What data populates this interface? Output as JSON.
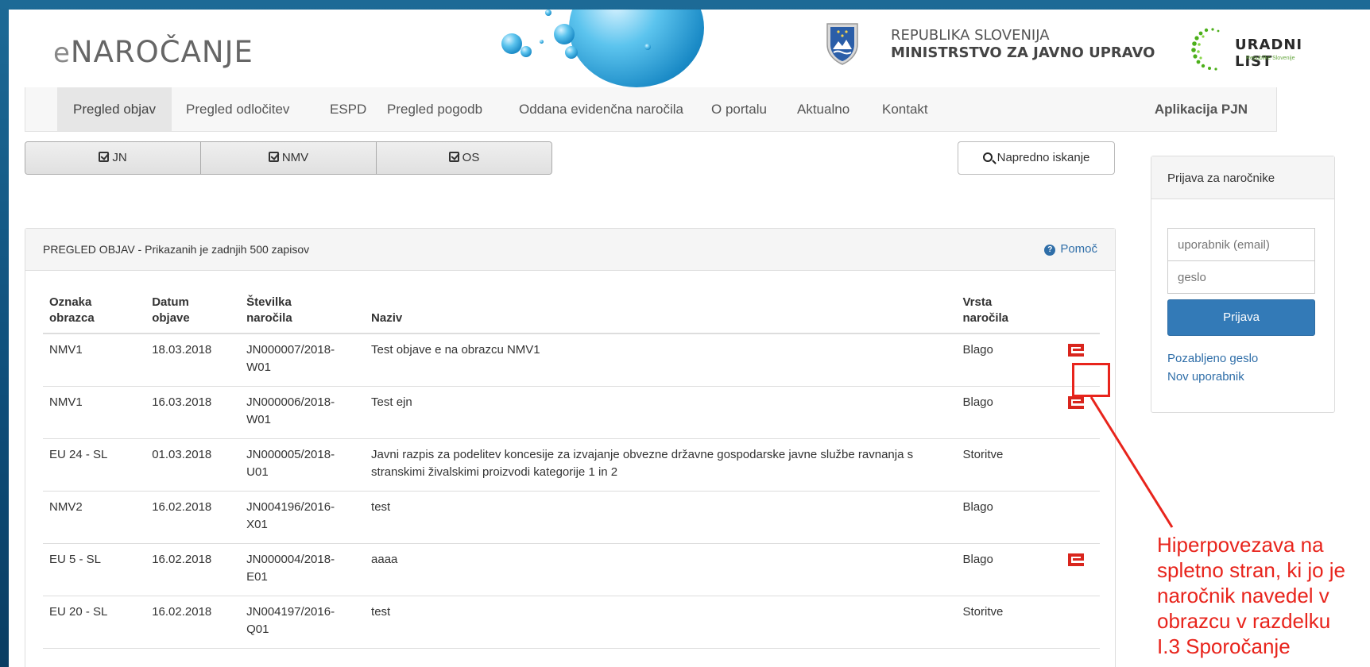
{
  "header": {
    "logo_e": "e",
    "logo_text": "NAROČANJE",
    "ministry_line1": "REPUBLIKA SLOVENIJA",
    "ministry_line2": "MINISTRSTVO ZA JAVNO UPRAVO",
    "uradni_list": "URADNI LIST",
    "uradni_sub": "Republike Slovenije"
  },
  "nav": {
    "items": [
      "Pregled objav",
      "Pregled odločitev",
      "ESPD",
      "Pregled pogodb",
      "Oddana evidenčna naročila",
      "O portalu",
      "Aktualno",
      "Kontakt"
    ],
    "active_index": 0,
    "right_item": "Aplikacija PJN"
  },
  "filters": [
    "JN",
    "NMV",
    "OS"
  ],
  "advanced_search": "Napredno iskanje",
  "panel": {
    "title": "PREGLED OBJAV - Prikazanih je zadnjih 500 zapisov",
    "help": "Pomoč",
    "columns": {
      "oznaka": [
        "Oznaka",
        "obrazca"
      ],
      "datum": [
        "Datum",
        "objave"
      ],
      "stevilka": [
        "Številka",
        "naročila"
      ],
      "naziv": "Naziv",
      "vrsta": [
        "Vrsta",
        "naročila"
      ]
    },
    "rows": [
      {
        "oznaka": "NMV1",
        "datum": "18.03.2018",
        "stevilka": [
          "JN000007/2018-",
          "W01"
        ],
        "naziv": "Test objave e na obrazcu NMV1",
        "vrsta": "Blago",
        "link": true
      },
      {
        "oznaka": "NMV1",
        "datum": "16.03.2018",
        "stevilka": [
          "JN000006/2018-",
          "W01"
        ],
        "naziv": "Test ejn",
        "vrsta": "Blago",
        "link": true
      },
      {
        "oznaka": "EU 24 - SL",
        "datum": "01.03.2018",
        "stevilka": [
          "JN000005/2018-",
          "U01"
        ],
        "naziv": "Javni razpis za podelitev koncesije za izvajanje obvezne državne gospodarske javne službe ravnanja s stranskimi živalskimi proizvodi kategorije 1 in 2",
        "vrsta": "Storitve",
        "link": false
      },
      {
        "oznaka": "NMV2",
        "datum": "16.02.2018",
        "stevilka": [
          "JN004196/2016-",
          "X01"
        ],
        "naziv": "test",
        "vrsta": "Blago",
        "link": false
      },
      {
        "oznaka": "EU 5 - SL",
        "datum": "16.02.2018",
        "stevilka": [
          "JN000004/2018-",
          "E01"
        ],
        "naziv": "aaaa",
        "vrsta": "Blago",
        "link": true
      },
      {
        "oznaka": "EU 20 - SL",
        "datum": "16.02.2018",
        "stevilka": [
          "JN004197/2016-",
          "Q01"
        ],
        "naziv": "test",
        "vrsta": "Storitve",
        "link": false
      }
    ]
  },
  "login": {
    "title": "Prijava za naročnike",
    "user_placeholder": "uporabnik (email)",
    "pass_placeholder": "geslo",
    "button": "Prijava",
    "forgot": "Pozabljeno geslo",
    "new_user": "Nov uporabnik"
  },
  "annotation": {
    "lines": [
      "Hiperpovezava na",
      "spletno stran, ki jo je",
      "naročnik navedel v",
      "obrazcu v razdelku",
      "I.3 Sporočanje"
    ],
    "color": "#e8241c"
  }
}
